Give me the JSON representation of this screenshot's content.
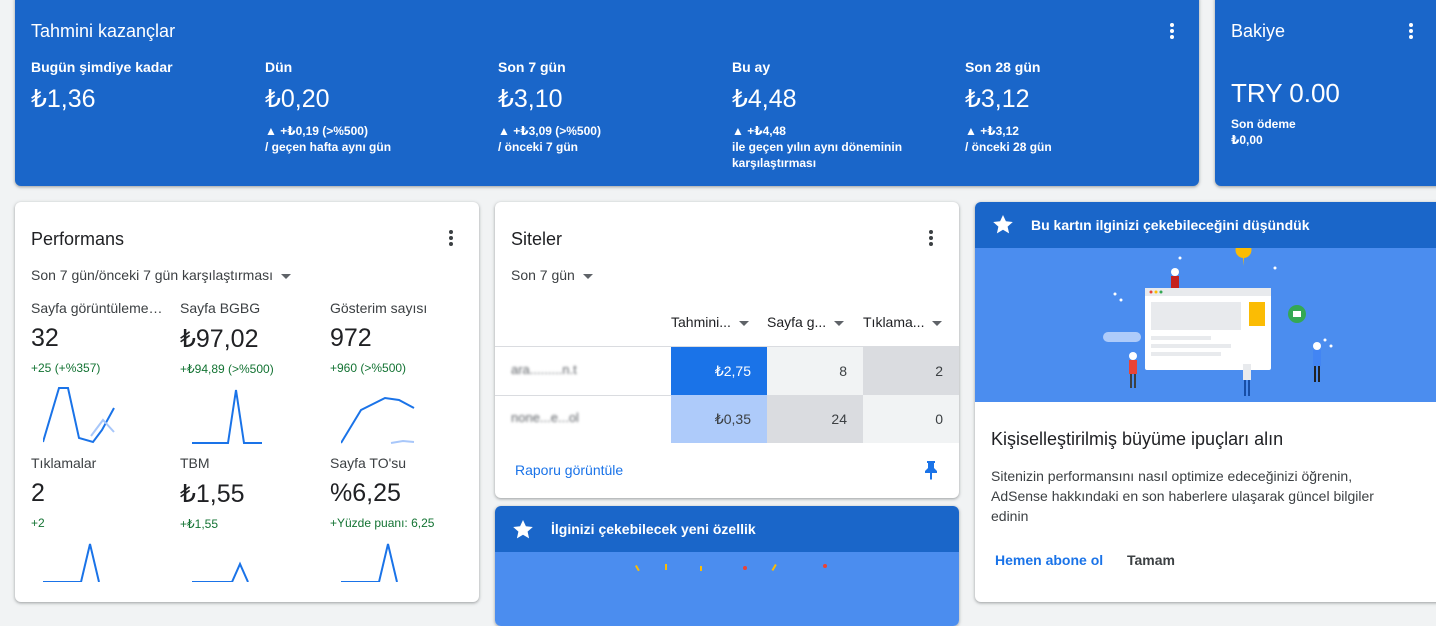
{
  "earnings": {
    "title": "Tahmini kazançlar",
    "columns": [
      {
        "label": "Bugün şimdiye kadar",
        "value": "₺1,36",
        "change": "",
        "compare": ""
      },
      {
        "label": "Dün",
        "value": "₺0,20",
        "change": "▲ +₺0,19 (>%500)",
        "compare": "/ geçen hafta aynı gün"
      },
      {
        "label": "Son 7 gün",
        "value": "₺3,10",
        "change": "▲ +₺3,09 (>%500)",
        "compare": "/ önceki 7 gün"
      },
      {
        "label": "Bu ay",
        "value": "₺4,48",
        "change": "▲ +₺4,48",
        "compare": "ile geçen yılın aynı döneminin karşılaştırması"
      },
      {
        "label": "Son 28 gün",
        "value": "₺3,12",
        "change": "▲ +₺3,12",
        "compare": "/ önceki 28 gün"
      }
    ]
  },
  "balance": {
    "title": "Bakiye",
    "value": "TRY 0.00",
    "last_payment_label": "Son ödeme",
    "last_payment_value": "₺0,00"
  },
  "performance": {
    "title": "Performans",
    "range": "Son 7 gün/önceki 7 gün karşılaştırması",
    "metrics": [
      {
        "label": "Sayfa görüntülemeleri",
        "value": "32",
        "change": "+25 (+%357)"
      },
      {
        "label": "Sayfa BGBG",
        "value": "₺97,02",
        "change": "+₺94,89 (>%500)"
      },
      {
        "label": "Gösterim sayısı",
        "value": "972",
        "change": "+960 (>%500)"
      },
      {
        "label": "Tıklamalar",
        "value": "2",
        "change": "+2"
      },
      {
        "label": "TBM",
        "value": "₺1,55",
        "change": "+₺1,55"
      },
      {
        "label": "Sayfa TO'su",
        "value": "%6,25",
        "change": "+Yüzde puanı: 6,25"
      }
    ]
  },
  "sites": {
    "title": "Siteler",
    "range": "Son 7 gün",
    "headers": [
      "Tahmini...",
      "Sayfa g...",
      "Tıklama..."
    ],
    "rows": [
      {
        "site": "ara.........n.t",
        "earnings": "₺2,75",
        "pageviews": "8",
        "clicks": "2"
      },
      {
        "site": "none...e...ol",
        "earnings": "₺0,35",
        "pageviews": "24",
        "clicks": "0"
      }
    ],
    "report_link": "Raporu görüntüle"
  },
  "feature": {
    "title": "İlginizi çekebilecek yeni özellik"
  },
  "suggestion": {
    "banner_title": "Bu kartın ilginizi çekebileceğini düşündük",
    "heading": "Kişiselleştirilmiş büyüme ipuçları alın",
    "body": "Sitenizin performansını nasıl optimize edeceğinizi öğrenin, AdSense hakkındaki en son haberlere ulaşarak güncel bilgiler edinin",
    "subscribe": "Hemen abone ol",
    "ok": "Tamam"
  },
  "colors": {
    "primary_blue": "#1a66c9",
    "cell_dark": "#1a73e8",
    "cell_light": "#aecbfa",
    "positive": "#137333"
  }
}
